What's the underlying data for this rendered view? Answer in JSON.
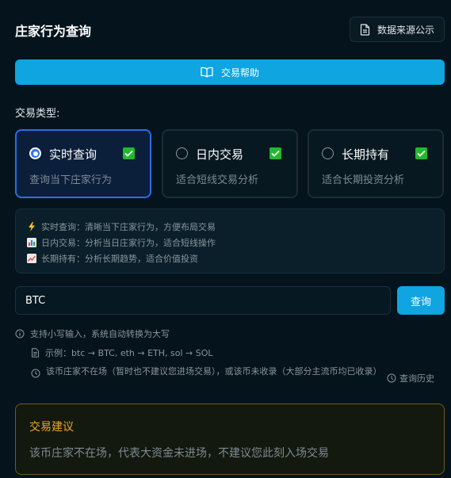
{
  "header": {
    "title": "庄家行为查询",
    "source_button": "数据来源公示",
    "help_button": "交易帮助"
  },
  "trade_type": {
    "label": "交易类型:",
    "options": [
      {
        "title": "实时查询",
        "desc": "查询当下庄家行为",
        "selected": true,
        "checked": true
      },
      {
        "title": "日内交易",
        "desc": "适合短线交易分析",
        "selected": false,
        "checked": true
      },
      {
        "title": "长期持有",
        "desc": "适合长期投资分析",
        "selected": false,
        "checked": true
      }
    ]
  },
  "info": [
    {
      "icon": "lightning-icon",
      "text": "实时查询：清晰当下庄家行为，方便布局交易"
    },
    {
      "icon": "bar-chart-icon",
      "text": "日内交易：分析当日庄家行为，适合短线操作"
    },
    {
      "icon": "line-chart-icon",
      "text": "长期持有：分析长期趋势，适合价值投资"
    }
  ],
  "search": {
    "value": "BTC",
    "button": "查询"
  },
  "hints": {
    "uppercase": "支持小写输入，系统自动转换为大写",
    "example": "示例：btc → BTC, eth → ETH, sol → SOL",
    "status": "该币庄家不在场（暂时也不建议您进场交易），或该币未收录（大部分主流币均已收录）",
    "history": "查询历史"
  },
  "advice": {
    "title": "交易建议",
    "text": "该币庄家不在场，代表大资金未进场，不建议您此刻入场交易"
  },
  "colors": {
    "accent": "#0ea5e0",
    "selected_border": "#2c6ee6",
    "check_green": "#22b82e",
    "advice_title": "#f2a528"
  }
}
